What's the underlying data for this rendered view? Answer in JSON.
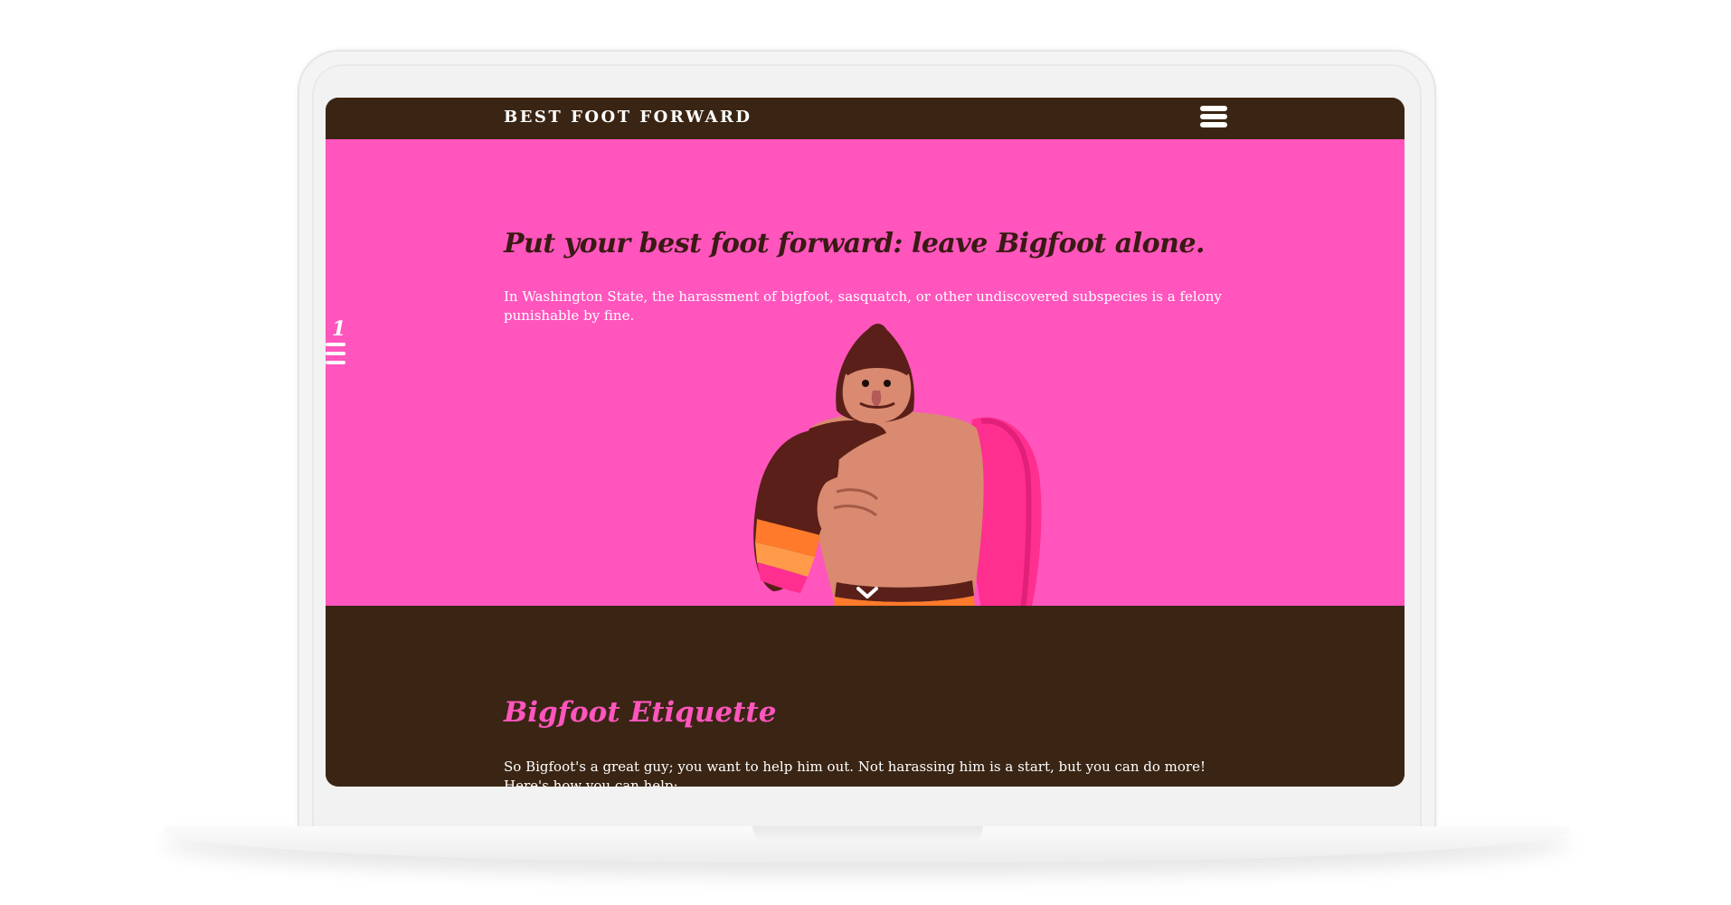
{
  "navbar": {
    "brand": "BEST FOOT FORWARD",
    "menu_icon": "hamburger-menu-icon"
  },
  "hero": {
    "title": "Put your best foot forward: leave Bigfoot alone.",
    "text": "In Washington State, the harassment of bigfoot, sasquatch, or other undiscovered subspecies is a felony punishable by fine.",
    "scroll_icon": "chevron-down-icon",
    "background_color": "#ff55bd"
  },
  "side_widget": {
    "number": "1",
    "icon": "list-lines-icon"
  },
  "section": {
    "title": "Bigfoot Etiquette",
    "text": "So Bigfoot's a great guy; you want to help him out. Not harassing him is a start, but you can do more! Here's how you can help:",
    "background_color": "#3a2514"
  },
  "colors": {
    "accent": "#ff55bd",
    "dark_brown": "#3a2514",
    "title_dark": "#3a1a14"
  }
}
